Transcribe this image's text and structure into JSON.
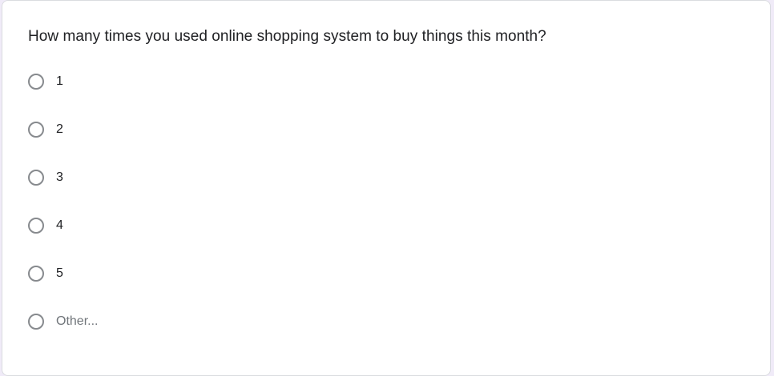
{
  "question": {
    "title": "How many times you used online shopping system to buy things this month?",
    "options": [
      {
        "label": "1",
        "selected": false
      },
      {
        "label": "2",
        "selected": false
      },
      {
        "label": "3",
        "selected": false
      },
      {
        "label": "4",
        "selected": false
      },
      {
        "label": "5",
        "selected": false
      },
      {
        "label": "Other...",
        "selected": false
      }
    ]
  }
}
